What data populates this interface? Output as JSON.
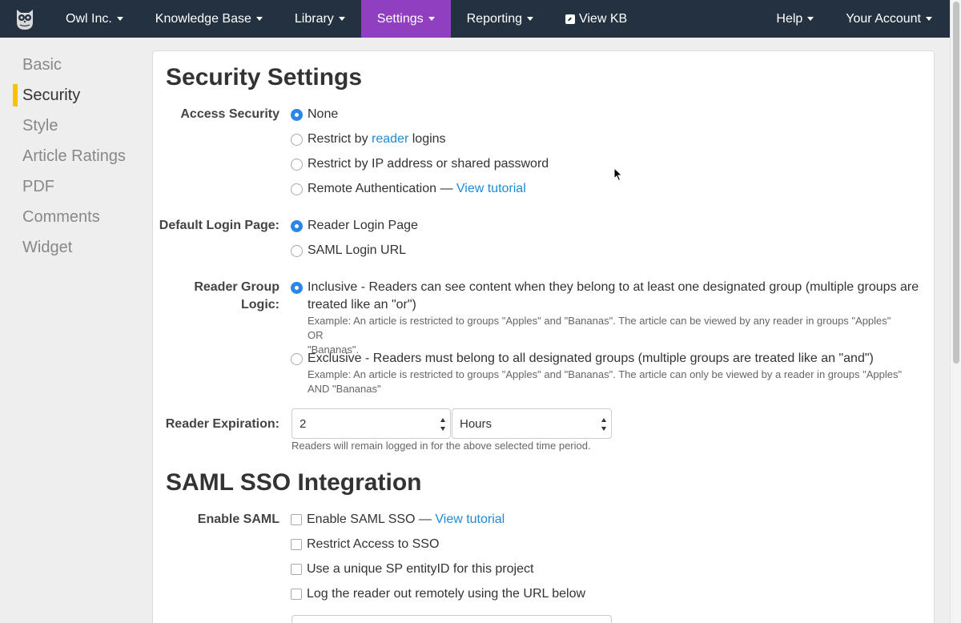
{
  "nav": {
    "items": [
      {
        "label": "Owl Inc.",
        "caret": true
      },
      {
        "label": "Knowledge Base",
        "caret": true
      },
      {
        "label": "Library",
        "caret": true
      },
      {
        "label": "Settings",
        "caret": true,
        "active": true
      },
      {
        "label": "Reporting",
        "caret": true
      },
      {
        "label": "View KB",
        "caret": false
      }
    ],
    "right": [
      {
        "label": "Help"
      },
      {
        "label": "Your Account"
      }
    ],
    "colors": {
      "bar": "#233140",
      "active": "#8f3fbf"
    }
  },
  "sidebar": {
    "items": [
      {
        "label": "Basic"
      },
      {
        "label": "Security",
        "active": true
      },
      {
        "label": "Style"
      },
      {
        "label": "Article Ratings"
      },
      {
        "label": "PDF"
      },
      {
        "label": "Comments"
      },
      {
        "label": "Widget"
      }
    ]
  },
  "security": {
    "title": "Security Settings",
    "access": {
      "label": "Access Security",
      "none": "None",
      "restrict_by": "Restrict by",
      "reader_link": "reader",
      "logins": "logins",
      "ip": "Restrict by IP address or shared password",
      "remote": "Remote Authentication —",
      "remote_link": "View tutorial"
    },
    "login_page": {
      "label": "Default Login Page:",
      "reader": "Reader Login Page",
      "saml": "SAML Login URL"
    },
    "group_logic": {
      "label_line1": "Reader Group",
      "label_line2": "Logic:",
      "inclusive_line1": "Inclusive - Readers can see content when they belong to at least one designated group (multiple groups are",
      "inclusive_line2": "treated like an \"or\")",
      "inclusive_ex_line1": "Example: An article is restricted to groups \"Apples\" and \"Bananas\". The article can be viewed by any reader in groups \"Apples\" OR",
      "inclusive_ex_line2": "\"Bananas\".",
      "exclusive": "Exclusive - Readers must belong to all designated groups (multiple groups are treated like an \"and\")",
      "exclusive_ex_line1": "Example: An article is restricted to groups \"Apples\" and \"Bananas\". The article can only be viewed by a reader in groups \"Apples\"",
      "exclusive_ex_line2": "AND \"Bananas\""
    },
    "expiration": {
      "label": "Reader Expiration:",
      "value": "2",
      "unit": "Hours",
      "help": "Readers will remain logged in for the above selected time period."
    }
  },
  "saml": {
    "title": "SAML SSO Integration",
    "label": "Enable SAML",
    "enable": "Enable SAML SSO —",
    "enable_link": "View tutorial",
    "restrict": "Restrict Access to SSO",
    "unique_sp": "Use a unique SP entityID for this project",
    "logout": "Log the reader out remotely using the URL below"
  }
}
